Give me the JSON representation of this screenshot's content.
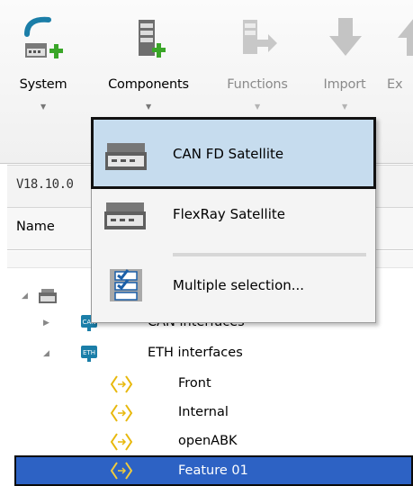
{
  "ribbon": {
    "buttons": [
      {
        "label": "System",
        "enabled": true,
        "icon": "system-add-icon"
      },
      {
        "label": "Components",
        "enabled": true,
        "icon": "components-add-icon"
      },
      {
        "label": "Functions",
        "enabled": false,
        "icon": "functions-icon"
      },
      {
        "label": "Import",
        "enabled": false,
        "icon": "import-icon"
      },
      {
        "label": "Ex",
        "enabled": false,
        "icon": "export-icon"
      }
    ]
  },
  "panel": {
    "version": "V18.10.0",
    "column_name": "Name"
  },
  "dropdown": {
    "items": [
      {
        "label": "CAN FD Satellite",
        "icon": "can-fd-satellite-icon",
        "highlighted": true
      },
      {
        "label": "FlexRay Satellite",
        "icon": "flexray-satellite-icon",
        "highlighted": false
      },
      {
        "label": "Multiple selection...",
        "icon": "multiple-selection-icon",
        "highlighted": false
      }
    ]
  },
  "tree": {
    "rows": [
      {
        "label": "",
        "icon": "device-icon",
        "expander": "expanded"
      },
      {
        "label": "CAN interfaces",
        "icon": "can-icon",
        "expander": "collapsed"
      },
      {
        "label": "ETH interfaces",
        "icon": "eth-icon",
        "expander": "expanded"
      },
      {
        "label": "Front",
        "icon": "port-icon"
      },
      {
        "label": "Internal",
        "icon": "port-icon"
      },
      {
        "label": "openABK",
        "icon": "port-icon"
      },
      {
        "label": "Feature 01",
        "icon": "port-icon",
        "selected": true
      }
    ]
  },
  "colors": {
    "selection": "#2d62c4",
    "menu_highlight": "#c6dcee",
    "accent_green": "#3aa628",
    "accent_teal": "#1b7ea8",
    "port_yellow": "#e8b80c"
  }
}
